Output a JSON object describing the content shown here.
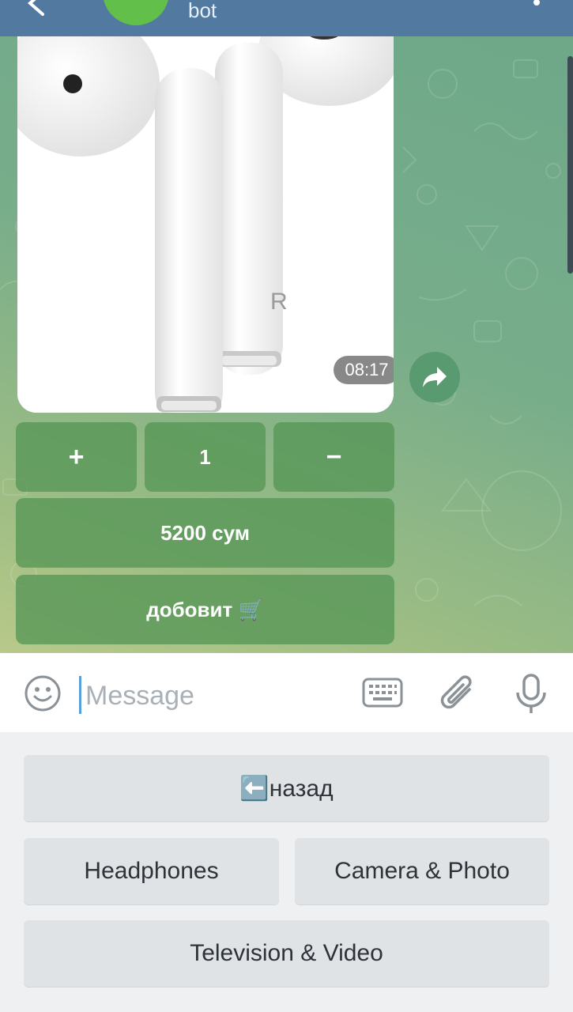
{
  "header": {
    "subtitle": "bot",
    "back_icon": "arrow-left-icon",
    "menu_icon": "vertical-dots-icon"
  },
  "message": {
    "time": "08:17",
    "share_icon": "share-arrow-icon"
  },
  "inline_keyboard": {
    "plus": "+",
    "quantity": "1",
    "minus": "−",
    "price": "5200 сум",
    "add": "добовит 🛒"
  },
  "input": {
    "placeholder": "Message"
  },
  "reply_keyboard": {
    "back": "⬅️назад",
    "headphones": "Headphones",
    "camera": "Camera & Photo",
    "tv": "Television & Video"
  },
  "colors": {
    "header": "#5279a0",
    "avatar": "#62c04a",
    "inline_button": "#5f9a5f",
    "chat_bg": "#78ad8a"
  }
}
